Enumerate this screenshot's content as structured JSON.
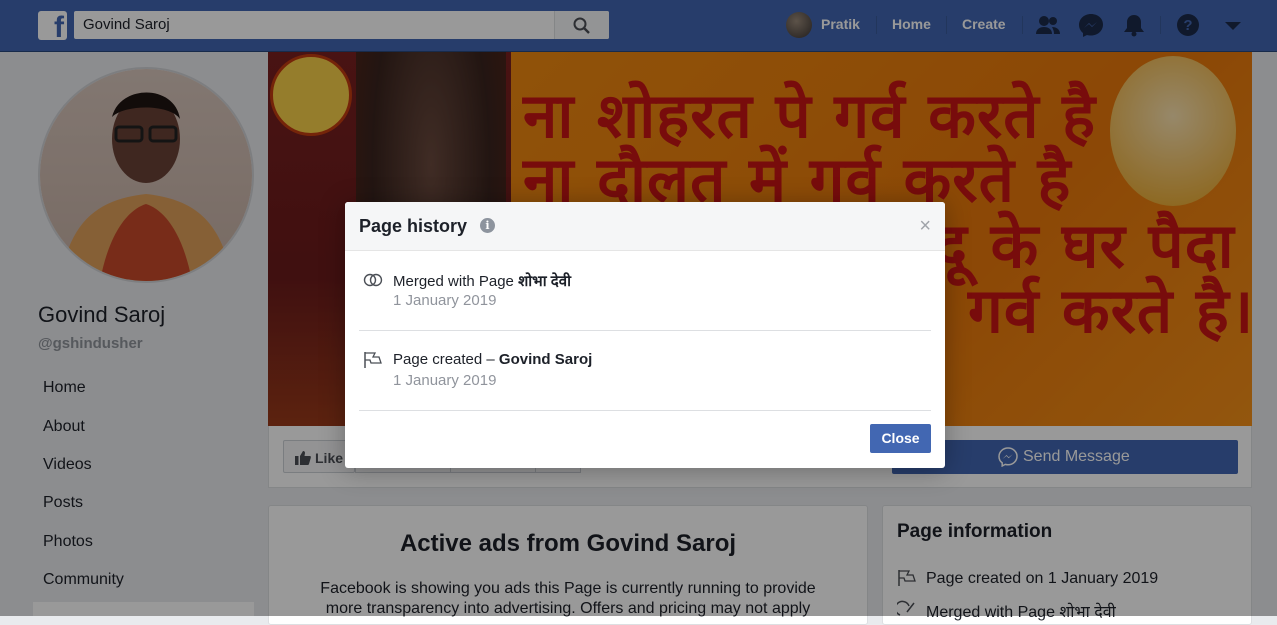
{
  "topbar": {
    "search_value": "Govind Saroj",
    "user_name": "Pratik",
    "home_label": "Home",
    "create_label": "Create",
    "icons": [
      "facebook-logo",
      "search-icon",
      "friends-icon",
      "messenger-icon",
      "notifications-icon",
      "help-icon",
      "chevron-down-icon"
    ]
  },
  "page": {
    "name": "Govind Saroj",
    "handle": "@gshindusher"
  },
  "left_nav": {
    "items": [
      "Home",
      "About",
      "Videos",
      "Posts",
      "Photos",
      "Community"
    ]
  },
  "cover": {
    "lines": [
      "ना शोहरत पे गर्व करते है",
      "ना दौलत में गर्व करते है",
      "न्दू के घर पैदा",
      "गर्व करते है।"
    ]
  },
  "actions": {
    "like_label": "Like",
    "send_message_label": "Send Message"
  },
  "ads": {
    "title": "Active ads from Govind Saroj",
    "desc_line1": "Facebook is showing you ads this Page is currently running to provide",
    "desc_line2": "more transparency into advertising. Offers and pricing may not apply"
  },
  "page_info": {
    "title": "Page information",
    "rows": [
      "Page created on 1 January 2019",
      "Merged with Page शोभा देवी"
    ]
  },
  "modal": {
    "title": "Page history",
    "close_x": "×",
    "items": [
      {
        "prefix": "Merged with Page ",
        "bold": "शोभा देवी",
        "date": "1 January 2019",
        "icon": "merge-icon"
      },
      {
        "prefix": "Page created – ",
        "bold": "Govind Saroj",
        "date": "1 January 2019",
        "icon": "flag-icon"
      }
    ],
    "close_label": "Close"
  },
  "colors": {
    "brand": "#4267b2",
    "background": "#e9ebee",
    "cover_text": "#c81414"
  }
}
